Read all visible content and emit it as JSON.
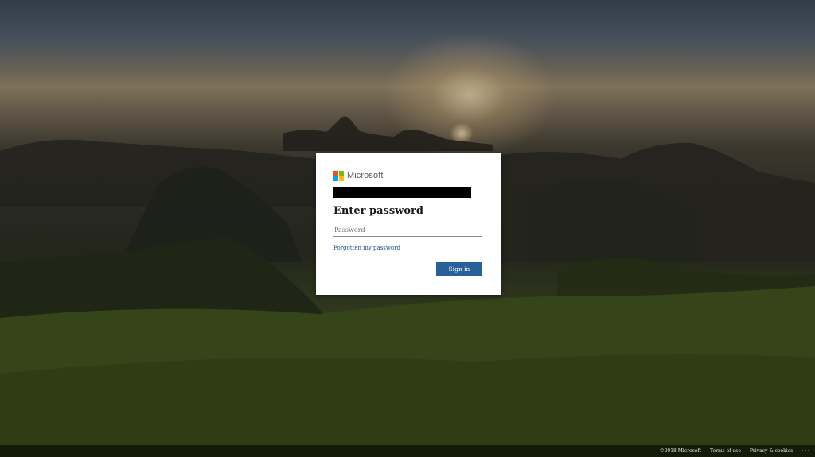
{
  "brand": {
    "name": "Microsoft",
    "logo_colors": [
      "#f25022",
      "#7fba00",
      "#00a4ef",
      "#ffb900"
    ]
  },
  "login": {
    "account_redacted": "",
    "title": "Enter password",
    "password_placeholder": "Password",
    "forgot_link": "Forgotten my password",
    "signin_button": "Sign in",
    "button_color": "#2a6098"
  },
  "footer": {
    "copyright": "©2018 Microsoft",
    "terms": "Terms of use",
    "privacy": "Privacy & cookies",
    "more": "···"
  }
}
